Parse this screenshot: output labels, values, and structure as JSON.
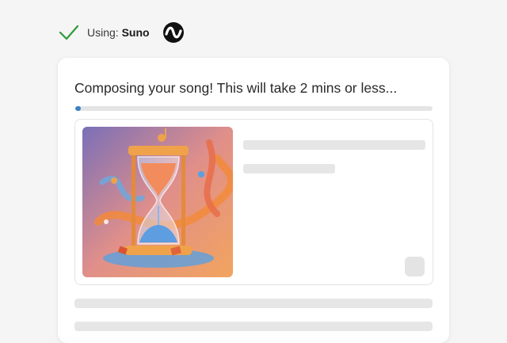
{
  "status": {
    "prefix": "Using: ",
    "provider": "Suno",
    "check_icon": "checkmark-icon",
    "logo_icon": "suno-logo-icon",
    "check_color": "#2e9a3a"
  },
  "card": {
    "title": "Composing your song! This will take 2 mins or less...",
    "progress": 0.01,
    "progress_color": "#3b82c4"
  },
  "song": {
    "cover_icon": "hourglass-music-artwork",
    "loading": true
  }
}
